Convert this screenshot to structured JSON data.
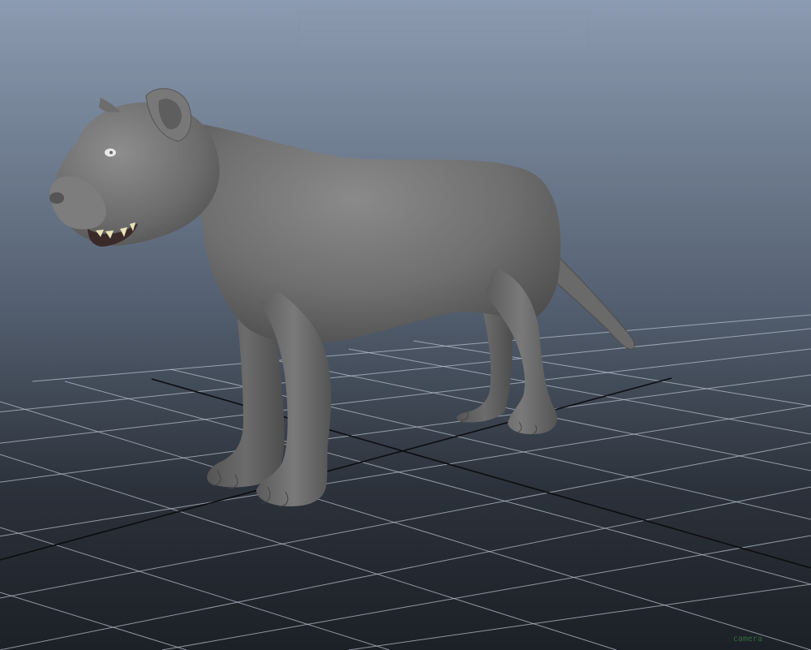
{
  "viewport": {
    "camera_label": "camera",
    "background_top": "#8c9bb1",
    "background_bottom": "#1c2027",
    "grid_color": "#b7bfca",
    "axis_color": "#0b0d10",
    "model_color": "#767676"
  },
  "hud": {
    "headline_icon": "hud-overlay"
  }
}
